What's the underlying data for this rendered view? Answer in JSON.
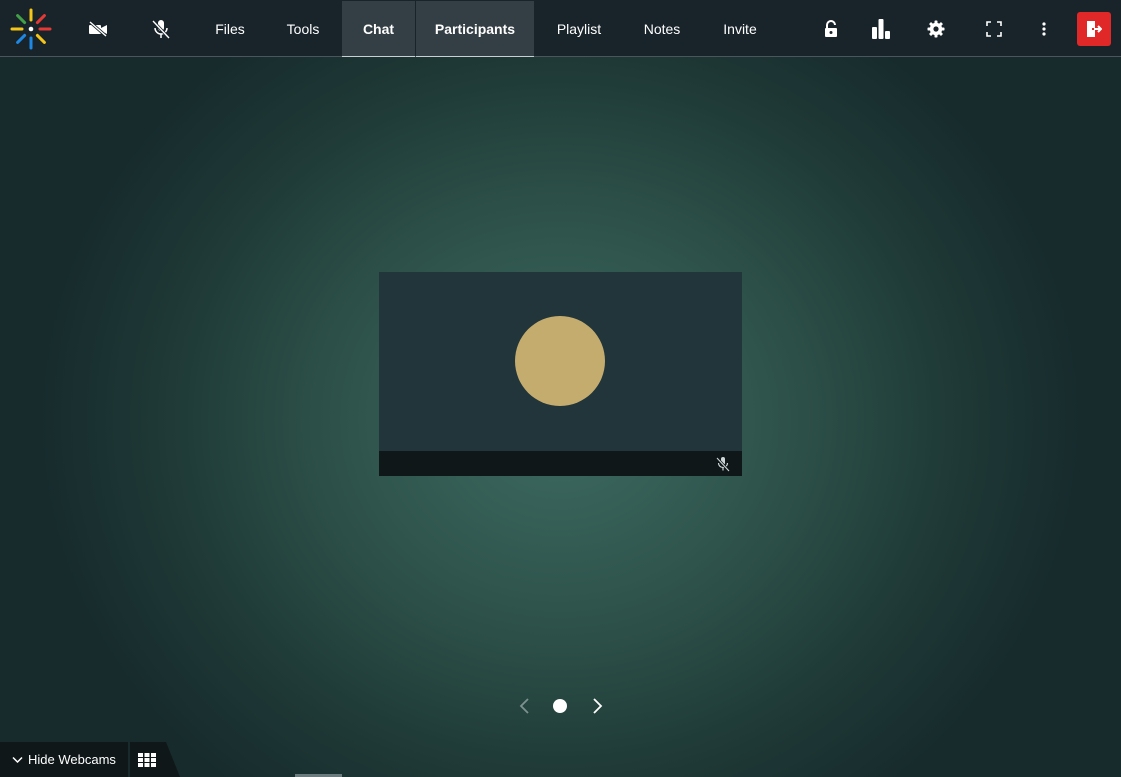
{
  "topbar": {
    "tabs": [
      {
        "label": "Files",
        "active": false
      },
      {
        "label": "Tools",
        "active": false
      },
      {
        "label": "Chat",
        "active": true
      },
      {
        "label": "Participants",
        "active": true
      },
      {
        "label": "Playlist",
        "active": false
      },
      {
        "label": "Notes",
        "active": false
      },
      {
        "label": "Invite",
        "active": false
      }
    ],
    "icons": {
      "logo": "logo-icon",
      "camera": "camera-off-icon",
      "mic": "mic-off-icon",
      "lock": "unlock-icon",
      "stats": "bar-chart-icon",
      "settings": "gear-icon",
      "fullscreen": "fullscreen-icon",
      "more": "more-vertical-icon",
      "exit": "exit-icon"
    },
    "exit_color": "#e02828"
  },
  "video": {
    "avatar_color": "#c4ac6f",
    "muted": true
  },
  "pager": {
    "pages": 1,
    "current": 1
  },
  "bottom": {
    "hide_webcams_label": "Hide Webcams"
  }
}
